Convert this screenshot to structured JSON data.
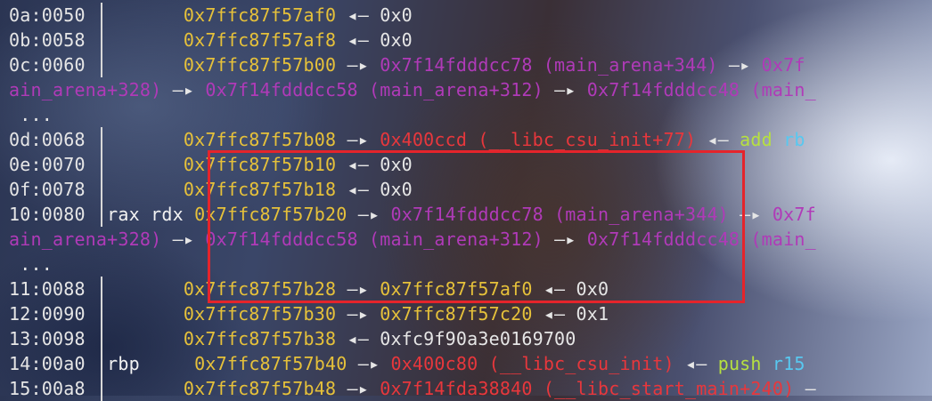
{
  "lines": [
    {
      "segments": [
        {
          "t": "0a:0050",
          "c": "off"
        },
        {
          "t": "         ",
          "c": "val"
        },
        {
          "t": "0x7ffc87f57af0",
          "c": "stk"
        },
        {
          "t": " ◂— ",
          "c": "arr"
        },
        {
          "t": "0x0",
          "c": "val"
        }
      ]
    },
    {
      "segments": [
        {
          "t": "0b:0058",
          "c": "off"
        },
        {
          "t": "         ",
          "c": "val"
        },
        {
          "t": "0x7ffc87f57af8",
          "c": "stk"
        },
        {
          "t": " ◂— ",
          "c": "arr"
        },
        {
          "t": "0x0",
          "c": "val"
        }
      ]
    },
    {
      "segments": [
        {
          "t": "0c:0060",
          "c": "off"
        },
        {
          "t": "         ",
          "c": "val"
        },
        {
          "t": "0x7ffc87f57b00",
          "c": "stk"
        },
        {
          "t": " —▸ ",
          "c": "arr"
        },
        {
          "t": "0x7f14fdddcc78 (main_arena+344)",
          "c": "heap"
        },
        {
          "t": " —▸ ",
          "c": "arr"
        },
        {
          "t": "0x7f",
          "c": "heap"
        }
      ]
    },
    {
      "segments": [
        {
          "t": "ain_arena+328)",
          "c": "heap"
        },
        {
          "t": " —▸ ",
          "c": "arr"
        },
        {
          "t": "0x7f14fdddcc58 (main_arena+312)",
          "c": "heap"
        },
        {
          "t": " —▸ ",
          "c": "arr"
        },
        {
          "t": "0x7f14fdddcc48 (main_",
          "c": "heap"
        }
      ]
    },
    {
      "segments": [
        {
          "t": " ...",
          "c": "val"
        }
      ]
    },
    {
      "segments": [
        {
          "t": "0d:0068",
          "c": "off"
        },
        {
          "t": "         ",
          "c": "val"
        },
        {
          "t": "0x7ffc87f57b08",
          "c": "stk"
        },
        {
          "t": " —▸ ",
          "c": "arr"
        },
        {
          "t": "0x400ccd (__libc_csu_init+77)",
          "c": "code"
        },
        {
          "t": " ◂— ",
          "c": "arr"
        },
        {
          "t": "add",
          "c": "ins"
        },
        {
          "t": " rb",
          "c": "op"
        }
      ]
    },
    {
      "segments": [
        {
          "t": "0e:0070",
          "c": "off"
        },
        {
          "t": "         ",
          "c": "val"
        },
        {
          "t": "0x7ffc87f57b10",
          "c": "stk"
        },
        {
          "t": " ◂— ",
          "c": "arr"
        },
        {
          "t": "0x0",
          "c": "val"
        }
      ]
    },
    {
      "segments": [
        {
          "t": "0f:0078",
          "c": "off"
        },
        {
          "t": "         ",
          "c": "val"
        },
        {
          "t": "0x7ffc87f57b18",
          "c": "stk"
        },
        {
          "t": " ◂— ",
          "c": "arr"
        },
        {
          "t": "0x0",
          "c": "val"
        }
      ]
    },
    {
      "segments": [
        {
          "t": "10:0080",
          "c": "off"
        },
        {
          "t": "  rax rdx ",
          "c": "reg"
        },
        {
          "t": "0x7ffc87f57b20",
          "c": "stk"
        },
        {
          "t": " —▸ ",
          "c": "arr"
        },
        {
          "t": "0x7f14fdddcc78 (main_arena+344)",
          "c": "heap"
        },
        {
          "t": " —▸ ",
          "c": "arr"
        },
        {
          "t": "0x7f",
          "c": "heap"
        }
      ]
    },
    {
      "segments": [
        {
          "t": "ain_arena+328)",
          "c": "heap"
        },
        {
          "t": " —▸ ",
          "c": "arr"
        },
        {
          "t": "0x7f14fdddcc58 (main_arena+312)",
          "c": "heap"
        },
        {
          "t": " —▸ ",
          "c": "arr"
        },
        {
          "t": "0x7f14fdddcc48 (main_",
          "c": "heap"
        }
      ]
    },
    {
      "segments": [
        {
          "t": " ...",
          "c": "val"
        }
      ]
    },
    {
      "segments": [
        {
          "t": "11:0088",
          "c": "off"
        },
        {
          "t": "         ",
          "c": "val"
        },
        {
          "t": "0x7ffc87f57b28",
          "c": "stk"
        },
        {
          "t": " —▸ ",
          "c": "arr"
        },
        {
          "t": "0x7ffc87f57af0",
          "c": "stk"
        },
        {
          "t": " ◂— ",
          "c": "arr"
        },
        {
          "t": "0x0",
          "c": "val"
        }
      ]
    },
    {
      "segments": [
        {
          "t": "12:0090",
          "c": "off"
        },
        {
          "t": "         ",
          "c": "val"
        },
        {
          "t": "0x7ffc87f57b30",
          "c": "stk"
        },
        {
          "t": " —▸ ",
          "c": "arr"
        },
        {
          "t": "0x7ffc87f57c20",
          "c": "stk"
        },
        {
          "t": " ◂— ",
          "c": "arr"
        },
        {
          "t": "0x1",
          "c": "val"
        }
      ]
    },
    {
      "segments": [
        {
          "t": "13:0098",
          "c": "off"
        },
        {
          "t": "         ",
          "c": "val"
        },
        {
          "t": "0x7ffc87f57b38",
          "c": "stk"
        },
        {
          "t": " ◂— ",
          "c": "arr"
        },
        {
          "t": "0xfc9f90a3e0169700",
          "c": "val"
        }
      ]
    },
    {
      "segments": [
        {
          "t": "14:00a0",
          "c": "off"
        },
        {
          "t": "  rbp     ",
          "c": "reg"
        },
        {
          "t": "0x7ffc87f57b40",
          "c": "stk"
        },
        {
          "t": " —▸ ",
          "c": "arr"
        },
        {
          "t": "0x400c80 (__libc_csu_init)",
          "c": "code"
        },
        {
          "t": " ◂— ",
          "c": "arr"
        },
        {
          "t": "push",
          "c": "ins"
        },
        {
          "t": " r15",
          "c": "op"
        }
      ]
    },
    {
      "segments": [
        {
          "t": "15:00a8",
          "c": "off"
        },
        {
          "t": "         ",
          "c": "val"
        },
        {
          "t": "0x7ffc87f57b48",
          "c": "stk"
        },
        {
          "t": " —▸ ",
          "c": "arr"
        },
        {
          "t": "0x7f14fda38840 (__libc_start_main+240)",
          "c": "code"
        },
        {
          "t": " —",
          "c": "arr"
        }
      ]
    }
  ],
  "separator_lines": [
    0,
    1,
    2,
    5,
    6,
    7,
    8,
    11,
    12,
    13,
    14,
    15
  ],
  "colors": {
    "offset": "#e6e6e6",
    "stack": "#e6c13a",
    "heap": "#b03ab8",
    "code": "#e8373c",
    "instruction": "#b6e040",
    "operand": "#58c8f0",
    "highlight": "#e5242b"
  }
}
